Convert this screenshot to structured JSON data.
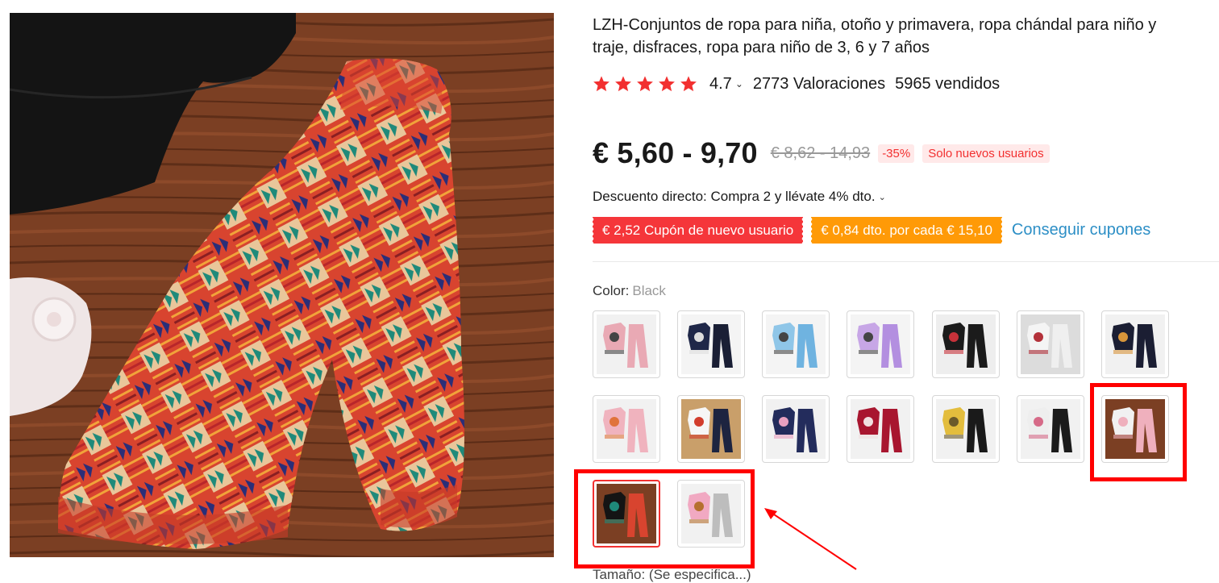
{
  "product": {
    "title_line1": "LZH-Conjuntos de ropa para niña, otoño y primavera, ropa chándal para niño y",
    "title_line2": "traje, disfraces, ropa para niño de 3, 6 y 7 años",
    "rating": "4.7",
    "reviews": "2773 Valoraciones",
    "sold": "5965 vendidos",
    "star_count": 5,
    "star_color": "#f23030"
  },
  "pricing": {
    "price": "€ 5,60 - 9,70",
    "original_price": "€ 8,62 - 14,93",
    "discount_pct": "-35%",
    "new_users_badge": "Solo nuevos usuarios",
    "direct_discount": "Descuento directo: Compra 2 y llévate 4% dto.",
    "coupon_new_user": "€ 2,52 Cupón de nuevo usuario",
    "coupon_per_amount": "€ 0,84 dto. por cada € 15,10",
    "get_coupons": "Conseguir cupones"
  },
  "variants": {
    "color_label": "Color:",
    "selected_color": "Black",
    "swatches": [
      {
        "icon": "pink-sweater-set-thumb"
      },
      {
        "icon": "navy-sweater-set-thumb"
      },
      {
        "icon": "blue-sweater-set-thumb"
      },
      {
        "icon": "purple-sweater-set-thumb"
      },
      {
        "icon": "black-rose-set-thumb"
      },
      {
        "icon": "white-rose-set-thumb"
      },
      {
        "icon": "black-print-set-thumb"
      },
      {
        "icon": "pink-print-set-thumb"
      },
      {
        "icon": "white-navy-set-thumb"
      },
      {
        "icon": "navy-unicorn-set-thumb"
      },
      {
        "icon": "burgundy-set-thumb"
      },
      {
        "icon": "yellow-camo-set-thumb"
      },
      {
        "icon": "white-floral-set-thumb"
      },
      {
        "icon": "pink-flare-set-thumb"
      },
      {
        "icon": "black-top-kente-pants-thumb",
        "selected": true
      },
      {
        "icon": "pink-tiger-set-thumb"
      }
    ]
  },
  "size_hint": "Tamaño: (Se especifica...)",
  "colors": {
    "accent_red": "#f23030",
    "coupon_red": "#f5363a",
    "coupon_orange": "#ff9a07",
    "link_blue": "#2d8fc6",
    "annotation_red": "#ff0000"
  }
}
